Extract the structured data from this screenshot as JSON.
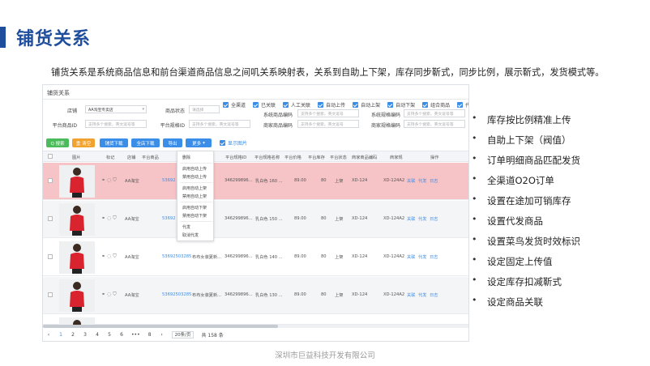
{
  "slide": {
    "title": "铺货关系",
    "intro": "铺货关系是系统商品信息和前台渠道商品信息之间叽关系映射表，关系到自助上下架，库存同步靳式，同步比例，展示靳式，发货模式等。",
    "footer": "深圳市巨益科技开发有限公司",
    "accent_color": "#1f4e9c"
  },
  "screenshot": {
    "panel_title": "铺货关系",
    "filters": {
      "shop_label": "店铺",
      "shop_value": "AA淘宝专卖店",
      "goods_status_label": "商品状态",
      "goods_status_placeholder": "请选择",
      "platform_goods_id_label": "平台商品ID",
      "platform_goods_id_placeholder": "支持多个搜索，英文逗号等",
      "platform_spec_id_label": "平台规格ID",
      "platform_spec_id_placeholder": "支持多个搜索，英文逗号等",
      "system_goods_code_label": "系统商品编码",
      "system_goods_code_placeholder": "支持多个搜索，英文逗号",
      "merchant_goods_code_label": "商家商品编码",
      "merchant_goods_code_placeholder": "支持多个搜索，英文逗号",
      "system_spec_code_label": "系统规格编码",
      "system_spec_code_placeholder": "支持多个搜索，英文逗号等",
      "merchant_spec_code_label": "商家规格编码",
      "merchant_spec_code_placeholder": "支持多个搜索，英文逗号等"
    },
    "checkboxes": [
      "全渠道",
      "已关联",
      "人工关联",
      "自动上传",
      "自动上架",
      "自动下架",
      "组合商品",
      "代发"
    ],
    "toolbar": {
      "search": "Q 搜索",
      "reset": "重 清空",
      "item_download": "铺货下载",
      "shop_download": "全店下载",
      "export": "导出",
      "more": "更多",
      "show_images": "显示图片"
    },
    "columns": [
      "图片",
      "标记",
      "店铺",
      "平台商品",
      "平台规格ID",
      "平台规格名称",
      "平台价格",
      "平台库存",
      "平台状态",
      "商家商品编码",
      "商家规",
      "操作"
    ],
    "rows": [
      {
        "shop": "AA淘宝",
        "goods_id": "53692",
        "spec_id": "346299896...",
        "spec_name": "乳白色 160 ...",
        "price": "89.00",
        "stock": "80",
        "status": "上架",
        "merchant_code": "XD-124",
        "merchant_spec": "XD-124A2",
        "ops": [
          "关联",
          "代发",
          "日志"
        ]
      },
      {
        "shop": "AA淘宝",
        "goods_id": "53692",
        "spec_id": "346299896...",
        "spec_name": "乳白色 150 ...",
        "price": "89.00",
        "stock": "80",
        "status": "上架",
        "merchant_code": "XD-124",
        "merchant_spec": "XD-124A2",
        "ops": [
          "关联",
          "代发",
          "日志"
        ]
      },
      {
        "shop": "AA淘宝",
        "goods_id": "53692503285",
        "goods_name": "布布女装夏新...",
        "spec_id": "346299896...",
        "spec_name": "乳白色 140 ...",
        "price": "89.00",
        "stock": "80",
        "status": "上架",
        "merchant_code": "XD-124",
        "merchant_spec": "XD-124A2",
        "ops": [
          "关联",
          "代发",
          "日志"
        ]
      },
      {
        "shop": "AA淘宝",
        "goods_id": "53692503285",
        "goods_name": "布布女装夏新...",
        "spec_id": "346299896...",
        "spec_name": "乳白色 130 ...",
        "price": "89.00",
        "stock": "80",
        "status": "上架",
        "merchant_code": "XD-124",
        "merchant_spec": "XD-124A2",
        "ops": [
          "关联",
          "代发",
          "日志"
        ]
      }
    ],
    "more_menu": [
      "删除",
      "启用自动上传",
      "禁用自动上传",
      "启用自动上架",
      "禁用自动上架",
      "启用自动下架",
      "禁用自动下架",
      "代发",
      "取消代发"
    ],
    "pagination": {
      "prev": "‹",
      "pages": [
        "1",
        "2",
        "3",
        "4",
        "5",
        "6",
        "•••",
        "8"
      ],
      "next": "›",
      "page_size": "20条/页",
      "total": "共 158 条",
      "current_page": "1"
    }
  },
  "features": [
    "库存按比例精准上传",
    "自助上下架（阀值）",
    "订单明细商品匹配发货",
    "全渠道O2O订单",
    "设置在途加可销库存",
    "设置代发商品",
    "设置菜鸟发货时效标识",
    "设定固定上传值",
    "设定库存扣减靳式",
    "设定商品关联"
  ]
}
